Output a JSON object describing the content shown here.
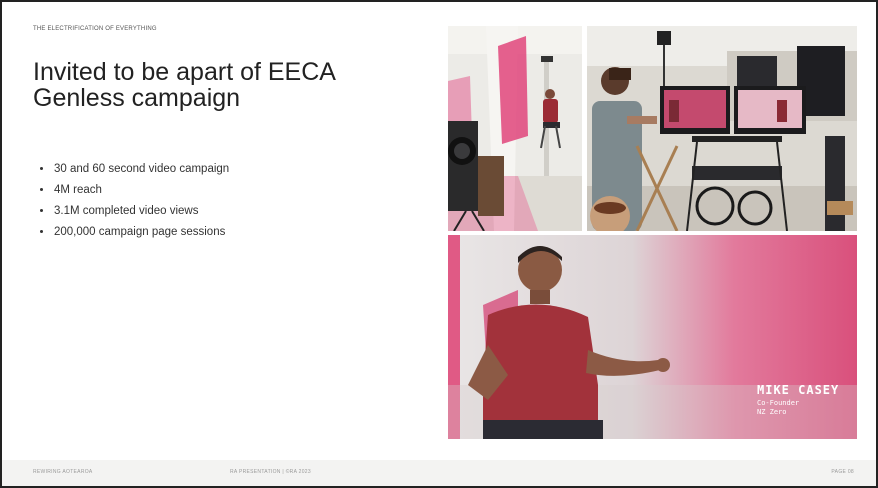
{
  "slide": {
    "kicker": "THE ELECTRIFICATION OF EVERYTHING",
    "title": "Invited to be apart of EECA Genless campaign",
    "bullets": [
      "30 and 60 second video campaign",
      "4M reach",
      "3.1M completed video views",
      "200,000 campaign page sessions"
    ]
  },
  "photos": {
    "photo3": {
      "caption_name": "MIKE CASEY",
      "caption_role": "Co-Founder",
      "caption_org": "NZ Zero"
    }
  },
  "footer": {
    "left": "REWIRING AOTEAROA",
    "center": "RA PRESENTATION  |  ©RA 2023",
    "right": "PAGE 08"
  },
  "colors": {
    "accent_pink": "#e0457b",
    "title_text": "#222222",
    "footer_text": "#9a9a9a"
  }
}
